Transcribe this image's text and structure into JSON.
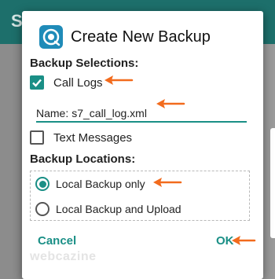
{
  "appbar": {
    "title_initial": "S",
    "menu_glyph": "⋮"
  },
  "dialog": {
    "title": "Create New Backup",
    "icon": "backup-app-icon",
    "selections_heading": "Backup Selections:",
    "call_logs": {
      "label": "Call Logs",
      "checked": true
    },
    "name_field": {
      "prefix": "Name:",
      "value": "s7_call_log.xml"
    },
    "text_messages": {
      "label": "Text Messages",
      "checked": false
    },
    "locations_heading": "Backup Locations:",
    "locations": [
      {
        "label": "Local Backup only",
        "selected": true
      },
      {
        "label": "Local Backup and Upload",
        "selected": false
      }
    ],
    "cancel_label": "Cancel",
    "ok_label": "OK"
  },
  "watermark": "webcazine",
  "colors": {
    "accent": "#1a8f86",
    "arrow": "#f26b1d",
    "appbar": "#1d6f6b"
  }
}
